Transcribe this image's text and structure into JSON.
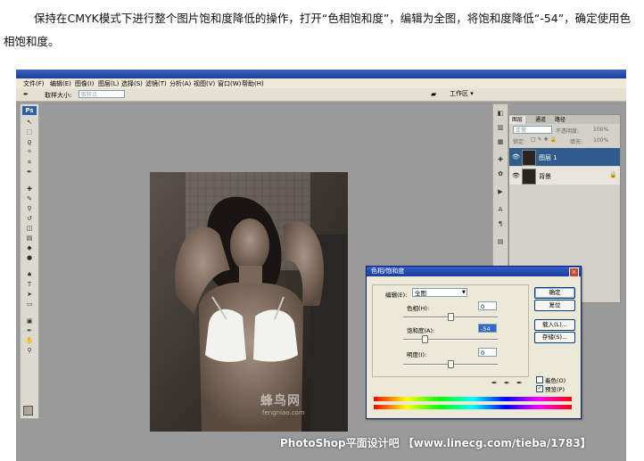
{
  "intro": {
    "text": "保持在CMYK模式下进行整个图片饱和度降低的操作，打开“色相饱和度”，编辑为全图，将饱和度降低“-54”，确定使用色相饱和度。"
  },
  "menubar": {
    "items": [
      "文件(F)",
      "编辑(E)",
      "图像(I)",
      "图层(L)",
      "选择(S)",
      "滤镜(T)",
      "分析(A)",
      "视图(V)",
      "窗口(W)",
      "帮助(H)"
    ]
  },
  "options": {
    "sample_label": "取样大小:",
    "sample_value": "取样点",
    "workspace": "工作区 ▾"
  },
  "toolbox": {
    "ps": "Ps"
  },
  "canvas": {
    "watermark_cn": "蜂鸟网",
    "watermark_url": "fengniao.com"
  },
  "footer_watermark": "PhotoShop平面设计吧 【www.linecg.com/tieba/1783】",
  "layers_panel": {
    "tabs": [
      "图层",
      "通道",
      "路径"
    ],
    "blend_mode": "正常",
    "opacity_label": "不透明度:",
    "opacity_value": "100%",
    "lock_label": "锁定:",
    "fill_label": "填充:",
    "fill_value": "100%",
    "layers": [
      {
        "name": "图层 1",
        "selected": true
      },
      {
        "name": "背景",
        "selected": false
      }
    ]
  },
  "dialog": {
    "title": "色相/饱和度",
    "edit_label": "编辑(E):",
    "edit_value": "全图",
    "hue_label": "色相(H):",
    "hue_value": "0",
    "sat_label": "饱和度(A):",
    "sat_value": "-54",
    "light_label": "明度(I):",
    "light_value": "0",
    "ok_label": "确定",
    "reset_label": "复位",
    "load_label": "载入(L)...",
    "save_label": "存储(S)...",
    "colorize_label": "着色(O)",
    "preview_label": "预览(P)",
    "preview_checked": "✓",
    "hue_level": 0.5,
    "sat_level": 0.23,
    "light_level": 0.5
  }
}
